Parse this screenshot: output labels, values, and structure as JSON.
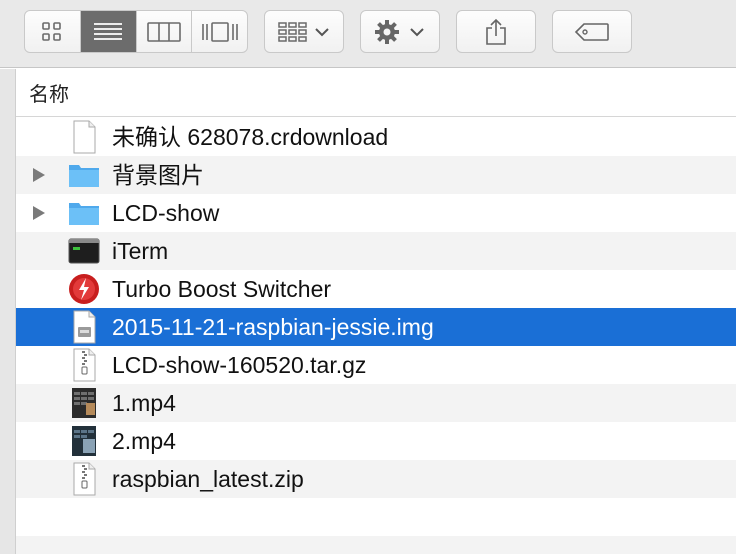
{
  "columns": {
    "name_header": "名称"
  },
  "files": [
    {
      "name": "未确认 628078.crdownload",
      "icon": "document-icon",
      "disclosure": false,
      "selected": false
    },
    {
      "name": "背景图片",
      "icon": "folder-icon",
      "disclosure": true,
      "selected": false
    },
    {
      "name": "LCD-show",
      "icon": "folder-icon",
      "disclosure": true,
      "selected": false
    },
    {
      "name": "iTerm",
      "icon": "terminal-app-icon",
      "disclosure": false,
      "selected": false
    },
    {
      "name": "Turbo Boost Switcher",
      "icon": "turbo-boost-app-icon",
      "disclosure": false,
      "selected": false
    },
    {
      "name": "2015-11-21-raspbian-jessie.img",
      "icon": "disk-image-icon",
      "disclosure": false,
      "selected": true
    },
    {
      "name": "LCD-show-160520.tar.gz",
      "icon": "archive-icon",
      "disclosure": false,
      "selected": false
    },
    {
      "name": "1.mp4",
      "icon": "video-thumbnail-icon",
      "disclosure": false,
      "selected": false
    },
    {
      "name": "2.mp4",
      "icon": "video-thumbnail-icon",
      "disclosure": false,
      "selected": false
    },
    {
      "name": "raspbian_latest.zip",
      "icon": "archive-icon",
      "disclosure": false,
      "selected": false
    }
  ],
  "colors": {
    "selection": "#1a6fd6",
    "folder": "#62b8f4",
    "alt_row": "#f3f3f3"
  }
}
